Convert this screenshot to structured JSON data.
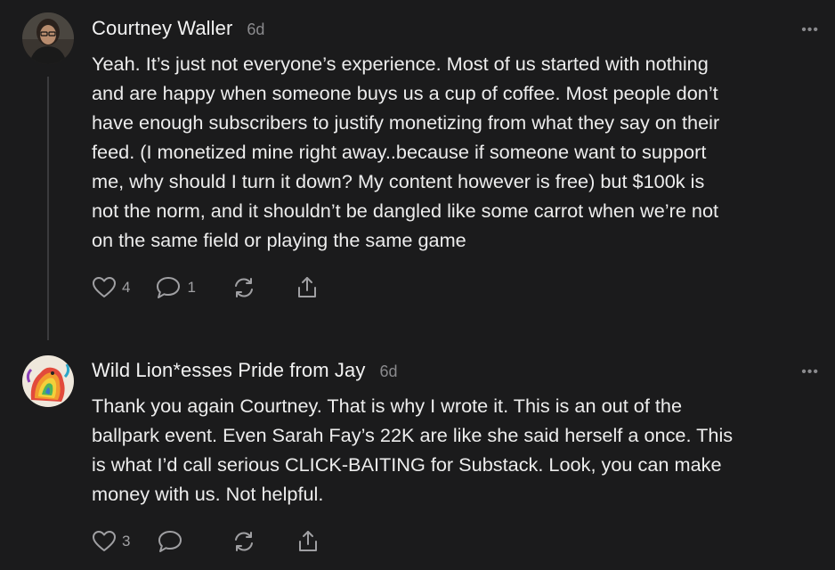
{
  "comments": [
    {
      "author": "Courtney Waller",
      "age": "6d",
      "more_label": "•••",
      "text": "Yeah. It’s just not everyone’s experience. Most of us started with nothing\nand are happy when someone buys us a cup of coffee. Most people don’t\nhave enough subscribers to justify monetizing from what they say on their\nfeed. (I monetized mine right away..because if someone want to support\nme, why should I turn it down? My content however is free) but $100k is\nnot the norm, and it shouldn’t be dangled like some carrot when we’re not\non the same field or playing the same game",
      "likes": "4",
      "replies": "1",
      "avatar_icon": "person-photo"
    },
    {
      "author": "Wild Lion*esses Pride from Jay",
      "age": "6d",
      "more_label": "•••",
      "text": "Thank you again Courtney. That is why I wrote it. This is an out of the\nballpark event. Even Sarah Fay’s 22K are like she said herself a once. This\nis what I’d call serious CLICK-BAITING for Substack. Look, you can make\nmoney with us. Not helpful.",
      "likes": "3",
      "replies": "",
      "avatar_icon": "rainbow-lion-art"
    }
  ],
  "icons": {
    "like": "heart-icon",
    "reply": "comment-bubble-icon",
    "restack": "restack-arrows-icon",
    "share": "share-icon"
  },
  "colors": {
    "background": "#1b1b1c",
    "text": "#ededed",
    "muted": "#8a8a8d",
    "thread_line": "#3b3b3d"
  }
}
